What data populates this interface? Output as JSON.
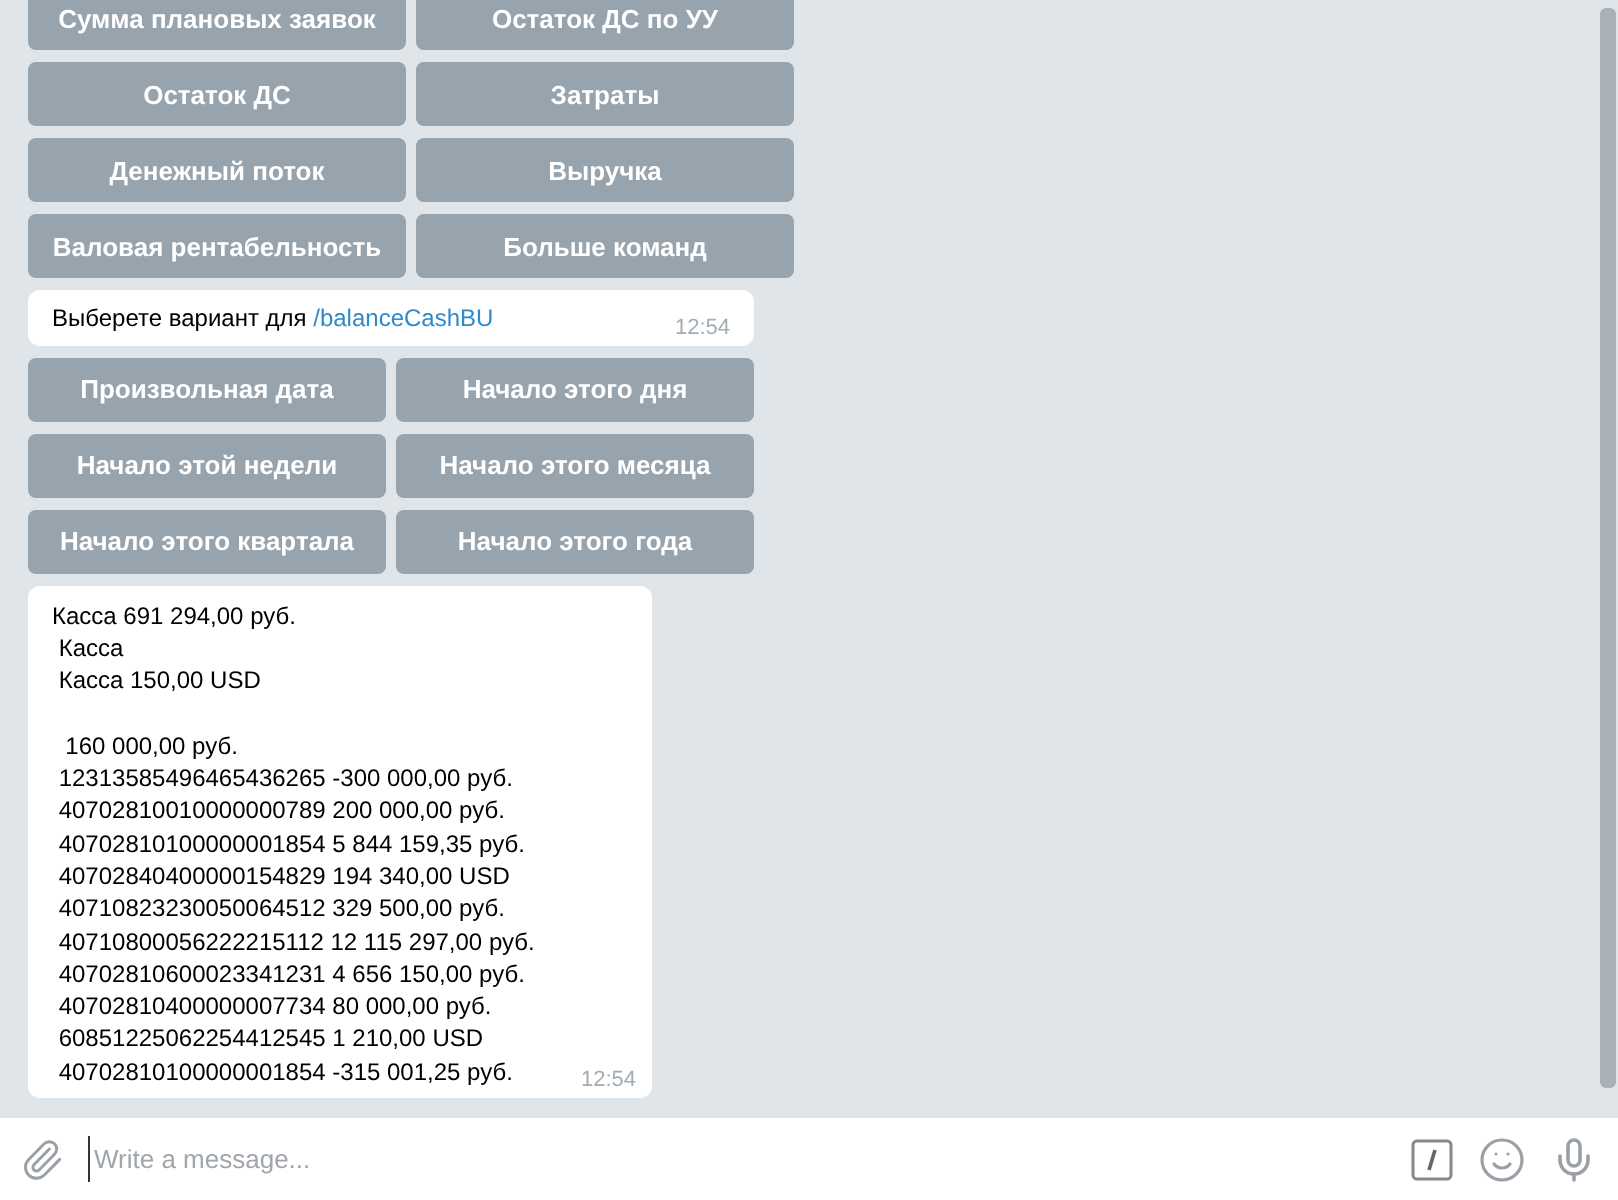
{
  "keyboard_1": {
    "buttons": [
      {
        "label": "Сумма плановых заявок"
      },
      {
        "label": "Остаток ДС по УУ"
      },
      {
        "label": "Остаток ДС"
      },
      {
        "label": "Затраты"
      },
      {
        "label": "Денежный поток"
      },
      {
        "label": "Выручка"
      },
      {
        "label": "Валовая рентабельность"
      },
      {
        "label": "Больше команд"
      }
    ]
  },
  "message_1": {
    "text": "Выберете вариант для ",
    "command": "/balanceCashBU",
    "time": "12:54"
  },
  "keyboard_2": {
    "buttons": [
      {
        "label": "Произвольная дата"
      },
      {
        "label": "Начало этого дня"
      },
      {
        "label": "Начало этой недели"
      },
      {
        "label": "Начало этого месяца"
      },
      {
        "label": "Начало этого квартала"
      },
      {
        "label": "Начало этого года"
      }
    ]
  },
  "message_2": {
    "text": "Касса 691 294,00 руб.\n Касса\n Касса 150,00 USD\n\n  160 000,00 руб.\n 12313585496465436265 -300 000,00 руб.\n 40702810010000000789 200 000,00 руб.\n 40702810100000001854 5 844 159,35 руб.\n 40702840400000154829 194 340,00 USD\n 40710823230050064512 329 500,00 руб.\n 40710800056222215112 12 115 297,00 руб.\n 40702810600023341231 4 656 150,00 руб.\n 40702810400000007734 80 000,00 руб.\n 60851225062254412545 1 210,00 USD\n 40702810100000001854 -315 001,25 руб.",
    "time": "12:54"
  },
  "composer": {
    "placeholder": "Write a message..."
  }
}
